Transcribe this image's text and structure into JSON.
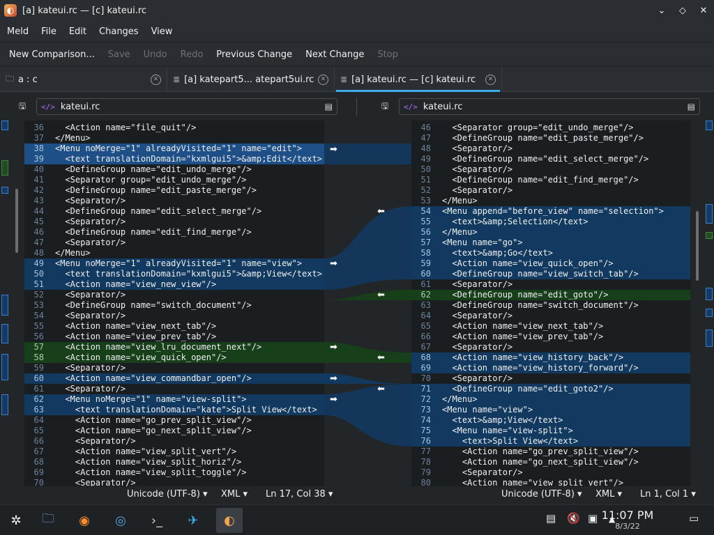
{
  "window": {
    "title": "[a] kateui.rc — [c] kateui.rc"
  },
  "menu": [
    "Meld",
    "File",
    "Edit",
    "Changes",
    "View"
  ],
  "toolbar": [
    {
      "label": "New Comparison...",
      "enabled": true
    },
    {
      "label": "Save",
      "enabled": false
    },
    {
      "label": "Undo",
      "enabled": false
    },
    {
      "label": "Redo",
      "enabled": false
    },
    {
      "label": "Previous Change",
      "enabled": true
    },
    {
      "label": "Next Change",
      "enabled": true
    },
    {
      "label": "Stop",
      "enabled": false
    }
  ],
  "tabs": [
    {
      "label": "a : c",
      "icon": "folder-icon"
    },
    {
      "label": "[a] katepart5... atepart5ui.rc",
      "icon": "document-icon"
    },
    {
      "label": "[a] kateui.rc — [c] kateui.rc",
      "icon": "document-icon",
      "active": true
    }
  ],
  "left": {
    "file": "kateui.rc"
  },
  "right": {
    "file": "kateui.rc"
  },
  "left_lines": [
    {
      "n": "36",
      "t": "  <Action name=\"file_quit\"/>"
    },
    {
      "n": "37",
      "t": "</Menu>"
    },
    {
      "n": "38",
      "t": "<Menu noMerge=\"1\" alreadyVisited=\"1\" name=\"edit\">",
      "c": "ch sel"
    },
    {
      "n": "39",
      "t": "  <text translationDomain=\"kxmlgui5\">&amp;Edit</text>",
      "c": "ch sel"
    },
    {
      "n": "40",
      "t": "  <DefineGroup name=\"edit_undo_merge\"/>"
    },
    {
      "n": "41",
      "t": "  <Separator group=\"edit_undo_merge\"/>"
    },
    {
      "n": "42",
      "t": "  <DefineGroup name=\"edit_paste_merge\"/>"
    },
    {
      "n": "43",
      "t": "  <Separator/>"
    },
    {
      "n": "44",
      "t": "  <DefineGroup name=\"edit_select_merge\"/>"
    },
    {
      "n": "45",
      "t": "  <Separator/>"
    },
    {
      "n": "46",
      "t": "  <DefineGroup name=\"edit_find_merge\"/>"
    },
    {
      "n": "47",
      "t": "  <Separator/>"
    },
    {
      "n": "48",
      "t": "</Menu>"
    },
    {
      "n": "49",
      "t": "<Menu noMerge=\"1\" alreadyVisited=\"1\" name=\"view\">",
      "c": "ch"
    },
    {
      "n": "50",
      "t": "  <text translationDomain=\"kxmlgui5\">&amp;View</text>",
      "c": "ch"
    },
    {
      "n": "51",
      "t": "  <Action name=\"view_new_view\"/>",
      "c": "ch"
    },
    {
      "n": "52",
      "t": "  <Separator/>"
    },
    {
      "n": "53",
      "t": "  <DefineGroup name=\"switch_document\"/>"
    },
    {
      "n": "54",
      "t": "  <Separator/>"
    },
    {
      "n": "55",
      "t": "  <Action name=\"view_next_tab\"/>"
    },
    {
      "n": "56",
      "t": "  <Action name=\"view_prev_tab\"/>"
    },
    {
      "n": "57",
      "t": "  <Action name=\"view_lru_document_next\"/>",
      "c": "ins"
    },
    {
      "n": "58",
      "t": "  <Action name=\"view_quick_open\"/>",
      "c": "ins"
    },
    {
      "n": "59",
      "t": "  <Separator/>"
    },
    {
      "n": "60",
      "t": "  <Action name=\"view_commandbar_open\"/>",
      "c": "ch"
    },
    {
      "n": "61",
      "t": "  <Separator/>"
    },
    {
      "n": "62",
      "t": "  <Menu noMerge=\"1\" name=\"view-split\">",
      "c": "ch"
    },
    {
      "n": "63",
      "t": "    <text translationDomain=\"kate\">Split View</text>",
      "c": "ch"
    },
    {
      "n": "64",
      "t": "    <Action name=\"go_prev_split_view\"/>"
    },
    {
      "n": "65",
      "t": "    <Action name=\"go_next_split_view\"/>"
    },
    {
      "n": "66",
      "t": "    <Separator/>"
    },
    {
      "n": "67",
      "t": "    <Action name=\"view_split_vert\"/>"
    },
    {
      "n": "68",
      "t": "    <Action name=\"view_split_horiz\"/>"
    },
    {
      "n": "69",
      "t": "    <Action name=\"view_split_toggle\"/>"
    },
    {
      "n": "70",
      "t": "    <Separator/>"
    }
  ],
  "right_lines": [
    {
      "n": "46",
      "t": "  <Separator group=\"edit_undo_merge\"/>"
    },
    {
      "n": "47",
      "t": "  <DefineGroup name=\"edit_paste_merge\"/>"
    },
    {
      "n": "48",
      "t": "  <Separator/>"
    },
    {
      "n": "49",
      "t": "  <DefineGroup name=\"edit_select_merge\"/>"
    },
    {
      "n": "50",
      "t": "  <Separator/>"
    },
    {
      "n": "51",
      "t": "  <DefineGroup name=\"edit_find_merge\"/>"
    },
    {
      "n": "52",
      "t": "  <Separator/>"
    },
    {
      "n": "53",
      "t": "</Menu>"
    },
    {
      "n": "54",
      "t": "<Menu append=\"before_view\" name=\"selection\">",
      "c": "ch"
    },
    {
      "n": "55",
      "t": "  <text>&amp;Selection</text>",
      "c": "ch"
    },
    {
      "n": "56",
      "t": "</Menu>",
      "c": "ch"
    },
    {
      "n": "57",
      "t": "<Menu name=\"go\">",
      "c": "ch"
    },
    {
      "n": "58",
      "t": "  <text>&amp;Go</text>",
      "c": "ch"
    },
    {
      "n": "59",
      "t": "  <Action name=\"view_quick_open\"/>",
      "c": "ch"
    },
    {
      "n": "60",
      "t": "  <DefineGroup name=\"view_switch_tab\"/>",
      "c": "ch"
    },
    {
      "n": "61",
      "t": "  <Separator/>"
    },
    {
      "n": "62",
      "t": "  <DefineGroup name=\"edit_goto\"/>",
      "c": "ins"
    },
    {
      "n": "63",
      "t": "  <DefineGroup name=\"switch_document\"/>"
    },
    {
      "n": "64",
      "t": "  <Separator/>"
    },
    {
      "n": "65",
      "t": "  <Action name=\"view_next_tab\"/>"
    },
    {
      "n": "66",
      "t": "  <Action name=\"view_prev_tab\"/>"
    },
    {
      "n": "67",
      "t": "  <Separator/>"
    },
    {
      "n": "68",
      "t": "  <Action name=\"view_history_back\"/>",
      "c": "ch"
    },
    {
      "n": "69",
      "t": "  <Action name=\"view_history_forward\"/>",
      "c": "ch"
    },
    {
      "n": "70",
      "t": "  <Separator/>"
    },
    {
      "n": "71",
      "t": "  <DefineGroup name=\"edit_goto2\"/>",
      "c": "ch"
    },
    {
      "n": "72",
      "t": "</Menu>",
      "c": "ch"
    },
    {
      "n": "73",
      "t": "<Menu name=\"view\">",
      "c": "ch"
    },
    {
      "n": "74",
      "t": "  <text>&amp;View</text>",
      "c": "ch"
    },
    {
      "n": "75",
      "t": "  <Menu name=\"view-split\">",
      "c": "ch"
    },
    {
      "n": "76",
      "t": "    <text>Split View</text>",
      "c": "ch"
    },
    {
      "n": "77",
      "t": "    <Action name=\"go_prev_split_view\"/>"
    },
    {
      "n": "78",
      "t": "    <Action name=\"go_next_split_view\"/>"
    },
    {
      "n": "79",
      "t": "    <Separator/>"
    },
    {
      "n": "80",
      "t": "    <Action name=\"view_split_vert\"/>"
    }
  ],
  "status": {
    "left_encoding": "Unicode (UTF-8)",
    "left_lang": "XML",
    "left_pos": "Ln 17, Col 38",
    "right_encoding": "Unicode (UTF-8)",
    "right_lang": "XML",
    "right_pos": "Ln 1, Col 1"
  },
  "taskbar": {
    "time": "11:07 PM",
    "date": "8/3/22"
  },
  "colors": {
    "changed": "#12395f",
    "inserted": "#173f1a",
    "accent": "#3daee9"
  }
}
